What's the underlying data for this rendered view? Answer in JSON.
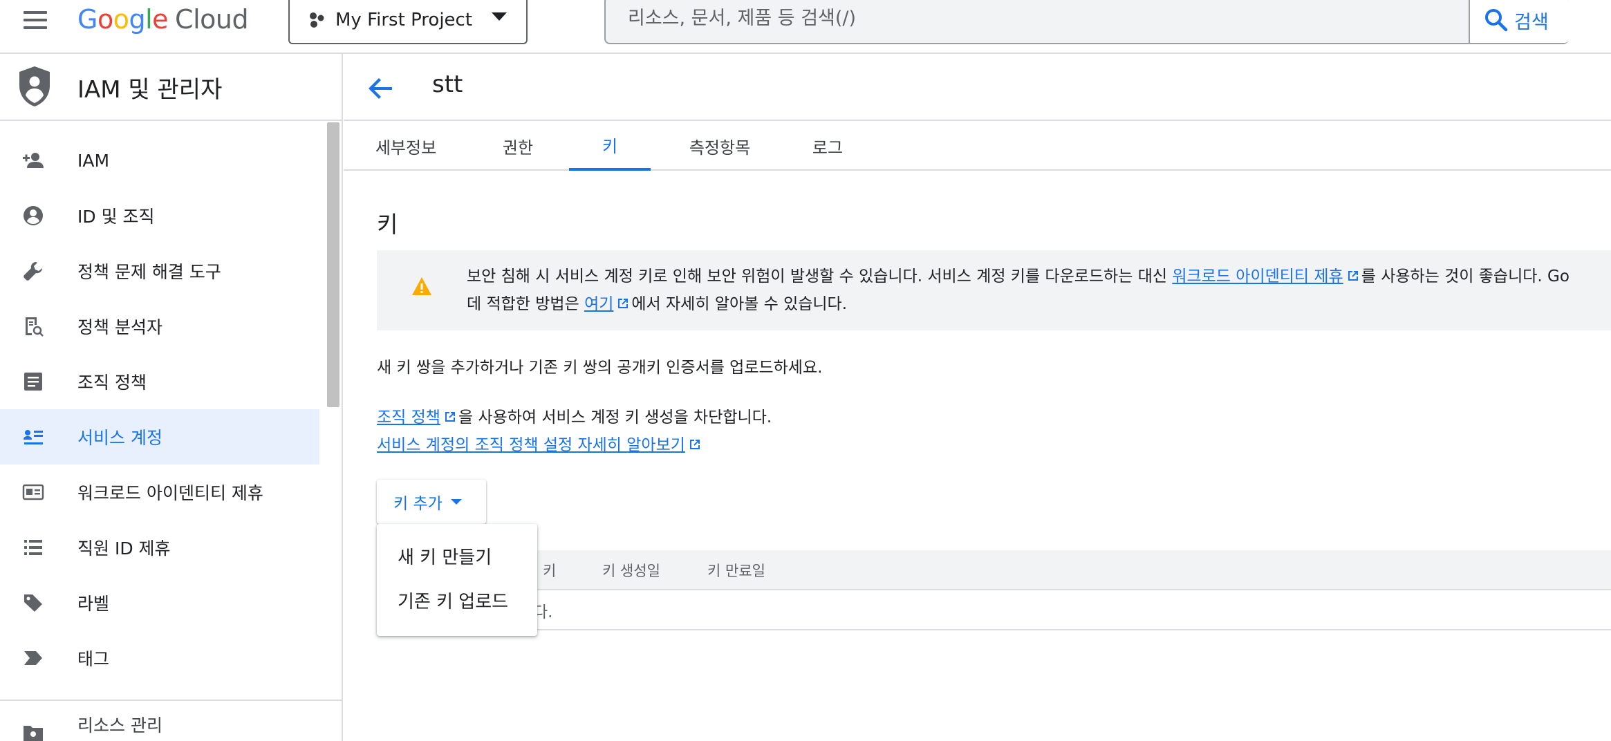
{
  "header": {
    "logo": {
      "g1": "G",
      "o1": "o",
      "o2": "o",
      "g2": "g",
      "l": "l",
      "e": "e",
      "cloud": "Cloud"
    },
    "project_picker": {
      "label": "My First Project"
    },
    "search": {
      "placeholder": "리소스, 문서, 제품 등 검색(/)",
      "button_label": "검색"
    }
  },
  "sidebar": {
    "title": "IAM 및 관리자",
    "items": [
      {
        "label": "IAM",
        "icon": "person-add-icon"
      },
      {
        "label": "ID 및 조직",
        "icon": "account-circle-icon"
      },
      {
        "label": "정책 문제 해결 도구",
        "icon": "wrench-icon"
      },
      {
        "label": "정책 분석자",
        "icon": "policy-search-icon"
      },
      {
        "label": "조직 정책",
        "icon": "article-icon"
      },
      {
        "label": "서비스 계정",
        "icon": "service-account-icon",
        "active": true
      },
      {
        "label": "워크로드 아이덴티티 제휴",
        "icon": "id-card-icon"
      },
      {
        "label": "직원 ID 제휴",
        "icon": "list-icon"
      },
      {
        "label": "라벨",
        "icon": "label-tag-icon"
      },
      {
        "label": "태그",
        "icon": "tag-chevron-icon"
      },
      {
        "label": "리소스 관리",
        "icon": "folder-settings-icon"
      }
    ]
  },
  "page": {
    "title": "stt",
    "tabs": [
      {
        "label": "세부정보"
      },
      {
        "label": "권한"
      },
      {
        "label": "키",
        "active": true
      },
      {
        "label": "측정항목"
      },
      {
        "label": "로그"
      }
    ],
    "section_title": "키",
    "warning": {
      "line1_pre": "보안 침해 시 서비스 계정 키로 인해 보안 위험이 발생할 수 있습니다. 서비스 계정 키를 다운로드하는 대신 ",
      "line1_link": "워크로드 아이덴티티 제휴",
      "line1_post": "를 사용하는 것이 좋습니다. Go",
      "line2_pre": "데 적합한 방법은 ",
      "line2_link": "여기",
      "line2_post": "에서 자세히 알아볼 수 있습니다."
    },
    "description": "새 키 쌍을 추가하거나 기존 키 쌍의 공개키 인증서를 업로드하세요.",
    "policy_link": "조직 정책",
    "policy_text": "을 사용하여 서비스 계정 키 생성을 차단합니다.",
    "learn_more_link": "서비스 계정의 조직 정책 설정 자세히 알아보기",
    "add_key_button": "키 추가",
    "dropdown": [
      "새 키 만들기",
      "기존 키 업로드"
    ],
    "table": {
      "columns": [
        "키",
        "키 생성일",
        "키 만료일"
      ],
      "empty_text": "다."
    }
  },
  "colors": {
    "accent": "#1a73e8",
    "warning": "#f9ab00",
    "active_bg": "#e8f0fe"
  }
}
